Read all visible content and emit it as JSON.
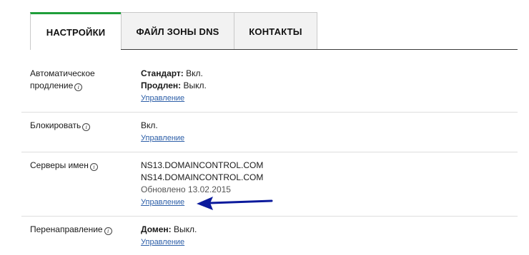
{
  "tabs": [
    {
      "label": "НАСТРОЙКИ",
      "active": true
    },
    {
      "label": "ФАЙЛ ЗОНЫ DNS",
      "active": false
    },
    {
      "label": "КОНТАКТЫ",
      "active": false
    }
  ],
  "colors": {
    "accent": "#1f9e3a",
    "link": "#2d5fa8",
    "arrow": "#0b1a9c"
  },
  "settings": {
    "autorenew": {
      "label_line1": "Автоматическое",
      "label_line2": "продление",
      "standard_label": "Стандарт:",
      "standard_value": "Вкл.",
      "extended_label": "Продлен:",
      "extended_value": "Выкл.",
      "manage": "Управление"
    },
    "lock": {
      "label": "Блокировать",
      "value": "Вкл.",
      "manage": "Управление"
    },
    "nameservers": {
      "label": "Серверы имен",
      "servers": [
        "NS13.DOMAINCONTROL.COM",
        "NS14.DOMAINCONTROL.COM"
      ],
      "updated": "Обновлено 13.02.2015",
      "manage": "Управление"
    },
    "forwarding": {
      "label": "Перенаправление",
      "domain_label": "Домен:",
      "domain_value": "Выкл.",
      "manage": "Управление"
    }
  },
  "icons": {
    "info": "info-icon",
    "annotation": "arrow-icon"
  }
}
